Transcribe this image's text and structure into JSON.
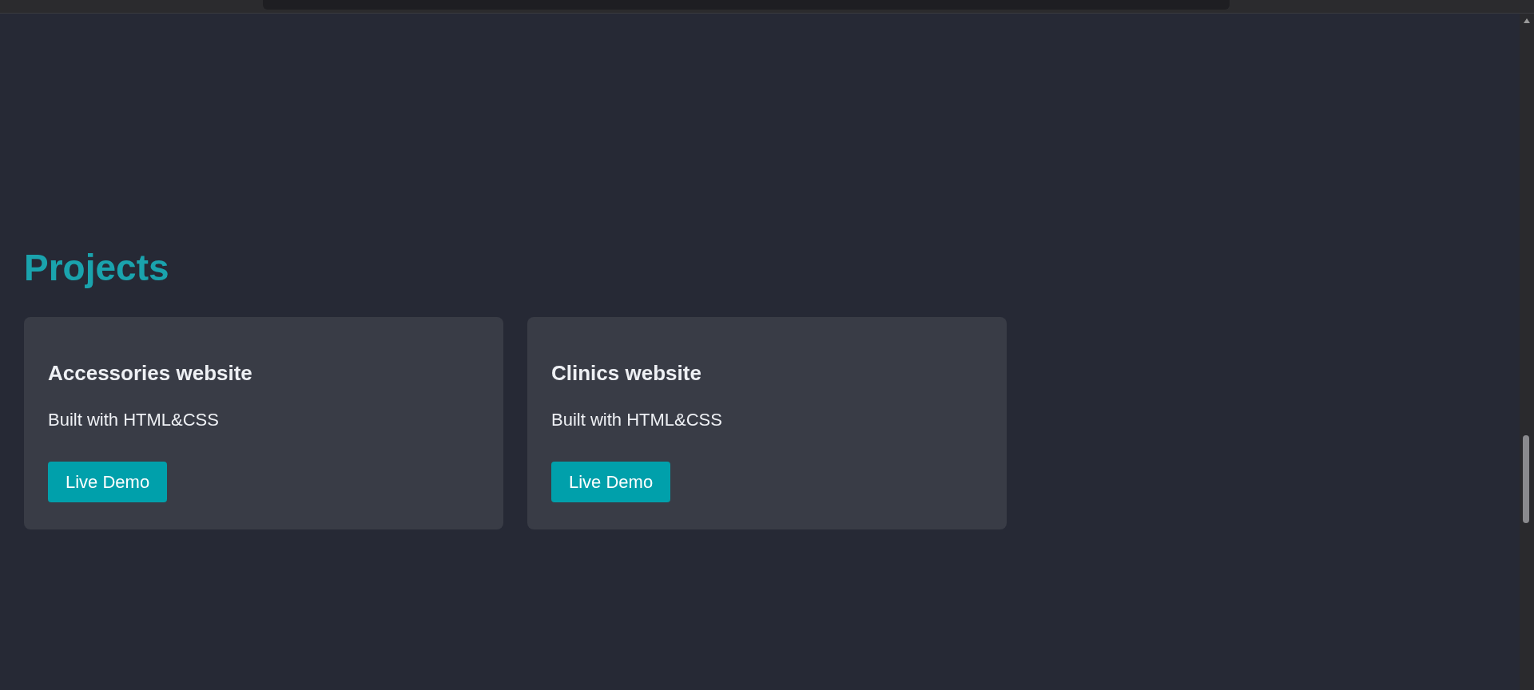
{
  "section": {
    "title": "Projects"
  },
  "projects": [
    {
      "title": "Accessories website",
      "description": "Built with HTML&CSS",
      "button": "Live Demo"
    },
    {
      "title": "Clinics website",
      "description": "Built with HTML&CSS",
      "button": "Live Demo"
    }
  ]
}
